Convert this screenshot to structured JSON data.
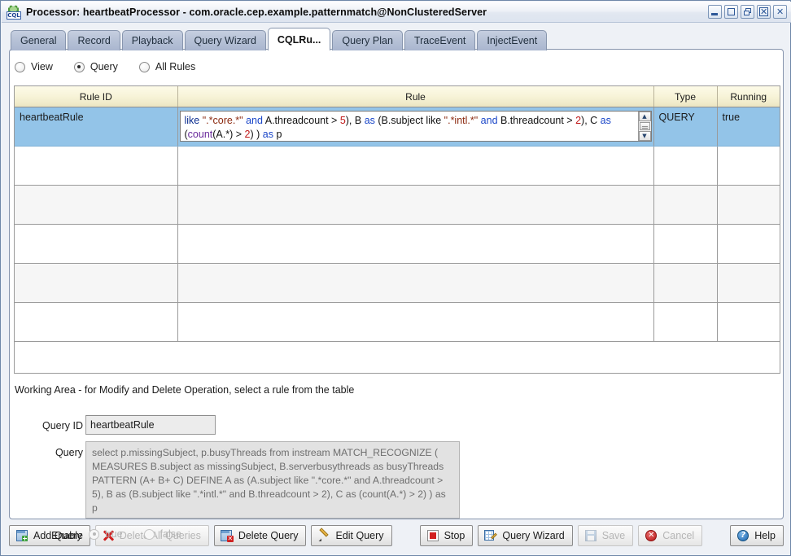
{
  "window": {
    "title": "Processor: heartbeatProcessor - com.oracle.cep.example.patternmatch@NonClusteredServer",
    "app_icon": "cql-gear-icon",
    "icon_text": "CQL",
    "controls": [
      {
        "name": "minimize-button",
        "glyph": "_"
      },
      {
        "name": "maximize-button",
        "glyph": "□"
      },
      {
        "name": "restore-button",
        "glyph": "❐"
      },
      {
        "name": "close-all-button",
        "glyph": "×"
      },
      {
        "name": "close-button",
        "glyph": "×"
      }
    ]
  },
  "tabs": [
    {
      "label": "General",
      "active": false
    },
    {
      "label": "Record",
      "active": false
    },
    {
      "label": "Playback",
      "active": false
    },
    {
      "label": "Query Wizard",
      "active": false
    },
    {
      "label": "CQLRu...",
      "active": true
    },
    {
      "label": "Query Plan",
      "active": false
    },
    {
      "label": "TraceEvent",
      "active": false
    },
    {
      "label": "InjectEvent",
      "active": false
    }
  ],
  "filter_radios": [
    {
      "label": "View",
      "selected": false
    },
    {
      "label": "Query",
      "selected": true
    },
    {
      "label": "All Rules",
      "selected": false
    }
  ],
  "table": {
    "columns": [
      "Rule ID",
      "Rule",
      "Type",
      "Running"
    ],
    "rows": [
      {
        "rule_id": "heartbeatRule",
        "rule_segments": [
          {
            "text": "like ",
            "style": "k"
          },
          {
            "text": "\".*core.*\"",
            "style": "str"
          },
          {
            "text": " and ",
            "style": "kb"
          },
          {
            "text": "A.threadcount > ",
            "style": "plain"
          },
          {
            "text": "5",
            "style": "num"
          },
          {
            "text": "), B ",
            "style": "plain"
          },
          {
            "text": "as ",
            "style": "kb"
          },
          {
            "text": "(B.subject like ",
            "style": "plain"
          },
          {
            "text": "\".*intl.*\"",
            "style": "str"
          },
          {
            "text": " and ",
            "style": "kb"
          },
          {
            "text": "B.threadcount > ",
            "style": "plain"
          },
          {
            "text": "2",
            "style": "num"
          },
          {
            "text": "), C ",
            "style": "plain"
          },
          {
            "text": "as ",
            "style": "kb"
          },
          {
            "text": "(",
            "style": "plain"
          },
          {
            "text": "count",
            "style": "fn"
          },
          {
            "text": "(A.*) > ",
            "style": "plain"
          },
          {
            "text": "2",
            "style": "num"
          },
          {
            "text": ") ) ",
            "style": "plain"
          },
          {
            "text": "as ",
            "style": "kb"
          },
          {
            "text": "p",
            "style": "plain"
          }
        ],
        "type": "QUERY",
        "running": "true",
        "selected": true
      },
      {
        "rule_id": "",
        "rule_segments": [],
        "type": "",
        "running": "",
        "selected": false
      },
      {
        "rule_id": "",
        "rule_segments": [],
        "type": "",
        "running": "",
        "selected": false
      },
      {
        "rule_id": "",
        "rule_segments": [],
        "type": "",
        "running": "",
        "selected": false
      },
      {
        "rule_id": "",
        "rule_segments": [],
        "type": "",
        "running": "",
        "selected": false
      },
      {
        "rule_id": "",
        "rule_segments": [],
        "type": "",
        "running": "",
        "selected": false
      }
    ]
  },
  "working_area": {
    "note": "Working Area - for Modify and Delete Operation, select a rule from the table",
    "query_id_label": "Query ID",
    "query_id_value": "heartbeatRule",
    "query_label": "Query",
    "query_value": "select p.missingSubject, p.busyThreads from instream MATCH_RECOGNIZE ( MEASURES B.subject as missingSubject, B.serverbusythreads as busyThreads PATTERN (A+ B+ C) DEFINE A as (A.subject like \".*core.*\" and A.threadcount > 5), B as (B.subject like \".*intl.*\" and B.threadcount > 2), C as (count(A.*) > 2) ) as p",
    "enable_label": "Enable",
    "enable_radios": [
      {
        "label": "true",
        "selected": true,
        "disabled": true
      },
      {
        "label": "false",
        "selected": false,
        "disabled": true
      }
    ]
  },
  "buttons": [
    {
      "label": "Add Query",
      "icon": "add-query-icon",
      "disabled": false
    },
    {
      "label": "Delete All Queries",
      "icon": "delete-all-icon",
      "disabled": true
    },
    {
      "label": "Delete Query",
      "icon": "delete-query-icon",
      "disabled": false
    },
    {
      "label": "Edit Query",
      "icon": "pencil-icon",
      "disabled": false
    },
    {
      "label": "Stop",
      "icon": "stop-icon",
      "disabled": false
    },
    {
      "label": "Query Wizard",
      "icon": "wizard-icon",
      "disabled": false
    },
    {
      "label": "Save",
      "icon": "save-icon",
      "disabled": true
    },
    {
      "label": "Cancel",
      "icon": "cancel-icon",
      "disabled": true
    },
    {
      "label": "Help",
      "icon": "help-icon",
      "disabled": false
    }
  ]
}
